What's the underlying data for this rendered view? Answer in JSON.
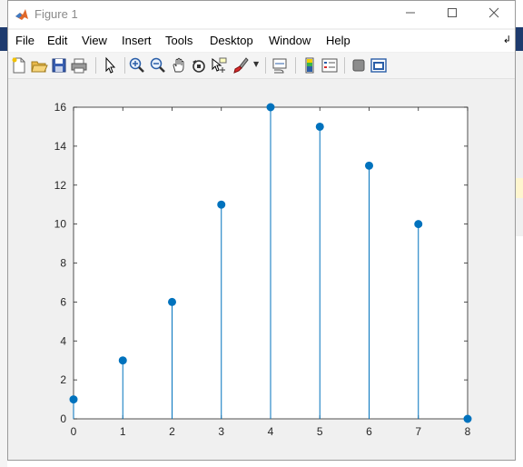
{
  "window": {
    "title": "Figure 1"
  },
  "menu": [
    "File",
    "Edit",
    "View",
    "Insert",
    "Tools",
    "Desktop",
    "Window",
    "Help"
  ],
  "colors": {
    "stem": "#0072bd",
    "axes_bg": "#ffffff",
    "figure_bg": "#f0f0f0",
    "title_text": "#8a8a8a"
  },
  "toolbar_icons": [
    "new-figure-icon",
    "open-file-icon",
    "save-icon",
    "print-icon",
    "pointer-icon",
    "zoom-in-icon",
    "zoom-out-icon",
    "pan-icon",
    "rotate-3d-icon",
    "data-cursor-icon",
    "brush-icon",
    "link-plot-icon",
    "insert-colorbar-icon",
    "insert-legend-icon",
    "hide-plot-tools-icon",
    "show-plot-tools-icon"
  ],
  "chart_data": {
    "type": "stem",
    "x": [
      0,
      1,
      2,
      3,
      4,
      5,
      6,
      7,
      8
    ],
    "y": [
      1,
      3,
      6,
      11,
      16,
      15,
      13,
      10,
      0
    ],
    "xlim": [
      0,
      8
    ],
    "ylim": [
      0,
      16
    ],
    "xticks": [
      "0",
      "1",
      "2",
      "3",
      "4",
      "5",
      "6",
      "7",
      "8"
    ],
    "yticks": [
      "0",
      "2",
      "4",
      "6",
      "8",
      "10",
      "12",
      "14",
      "16"
    ],
    "grid": false,
    "title": "",
    "xlabel": "",
    "ylabel": ""
  }
}
